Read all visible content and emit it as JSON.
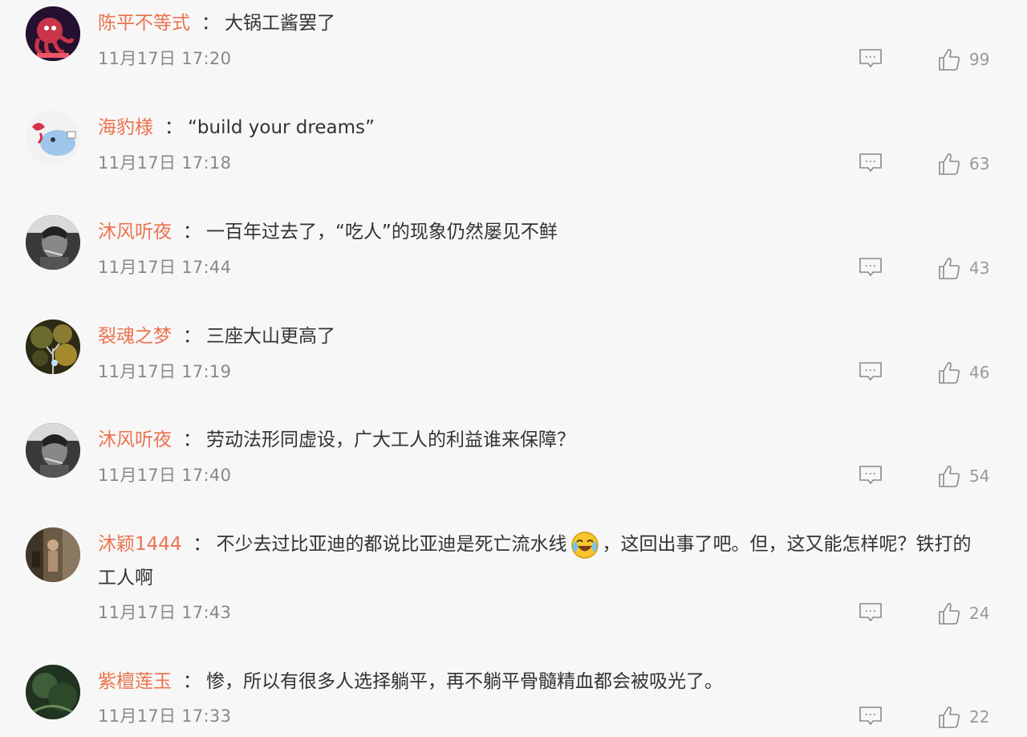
{
  "comments": [
    {
      "user": "陈平不等式",
      "text": "大锅工酱罢了",
      "time": "11月17日 17:20",
      "likes": "99",
      "avatar_icon": "red-octopus-avatar"
    },
    {
      "user": "海豹様",
      "text": "“build your dreams”",
      "time": "11月17日 17:18",
      "likes": "63",
      "avatar_icon": "cartoon-seal-avatar"
    },
    {
      "user": "沐风听夜",
      "text": "一百年过去了，“吃人”的现象仍然屡见不鲜",
      "time": "11月17日 17:44",
      "likes": "43",
      "avatar_icon": "sketch-portrait-avatar"
    },
    {
      "user": "裂魂之梦",
      "text": "三座大山更高了",
      "time": "11月17日 17:19",
      "likes": "46",
      "avatar_icon": "night-tree-avatar"
    },
    {
      "user": "沐风听夜",
      "text": "劳动法形同虚设，广大工人的利益谁来保障？",
      "time": "11月17日 17:40",
      "likes": "54",
      "avatar_icon": "sketch-portrait-avatar"
    },
    {
      "user": "沐颖1444",
      "text_before": "不少去过比亚迪的都说比亚迪是死亡流水线",
      "emoji": "laughing-crying-emoji",
      "text_after": "，这回出事了吧。但，这又能怎样呢？铁打的",
      "text_line2": "工人啊",
      "time": "11月17日 17:43",
      "likes": "24",
      "avatar_icon": "figure-photo-avatar"
    },
    {
      "user": "紫檀莲玉",
      "text": "惨，所以有很多人选择躺平，再不躺平骨髓精血都会被吸光了。",
      "time": "11月17日 17:33",
      "likes": "22",
      "avatar_icon": "dark-green-avatar"
    }
  ],
  "separator": "：",
  "icons": {
    "reply": "comment-icon",
    "like": "thumbs-up-icon"
  },
  "colors": {
    "username": "#eb7350",
    "text": "#333333",
    "time": "#888888",
    "count": "#999999",
    "background": "#f7f7f7"
  }
}
